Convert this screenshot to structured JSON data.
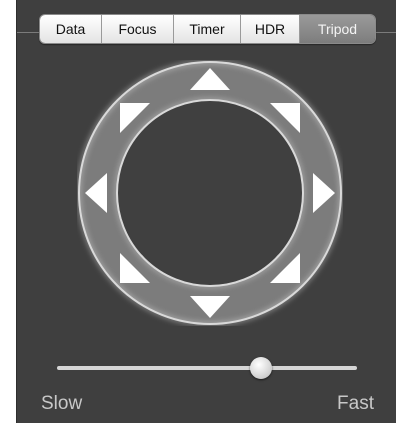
{
  "tabs": [
    {
      "label": "Data",
      "active": false
    },
    {
      "label": "Focus",
      "active": false
    },
    {
      "label": "Timer",
      "active": false
    },
    {
      "label": "HDR",
      "active": false
    },
    {
      "label": "Tripod",
      "active": true
    }
  ],
  "dial": {
    "directions": [
      "up",
      "up-right",
      "right",
      "down-right",
      "down",
      "down-left",
      "left",
      "up-left"
    ]
  },
  "speed_slider": {
    "value": 0.68,
    "min_label": "Slow",
    "max_label": "Fast"
  }
}
